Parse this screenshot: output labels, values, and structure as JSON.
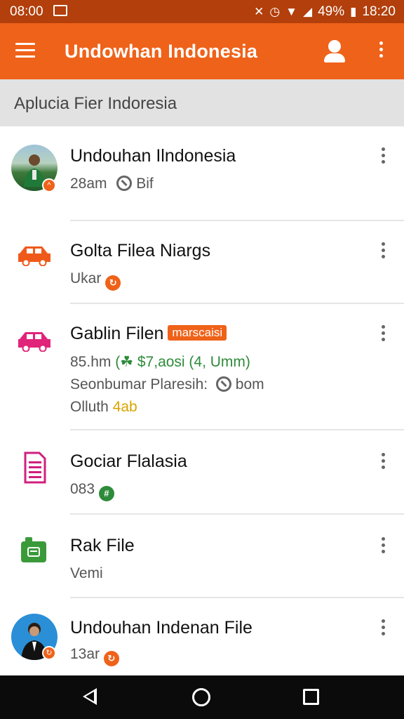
{
  "status_bar": {
    "time_left": "08:00",
    "battery": "49%",
    "time_right": "18:20"
  },
  "app_bar": {
    "title": "Undowhan Indonesia"
  },
  "subheader": {
    "label": "Aplucia Fier Indoresia"
  },
  "rows": [
    {
      "title": "Undouhan Ilndonesia",
      "line1a": "28am",
      "line1b": "Bif"
    },
    {
      "title": "Golta Filea Niargs",
      "line1": "Ukar"
    },
    {
      "title": "Gablin Filen",
      "tag": "marscaisi",
      "line1a": "85.hm",
      "line1b": "(☘ $7,aosi (4, Umm)",
      "line2a": "Seonbumar Plaresih:",
      "line2b": "bom",
      "line3a": "Olluth",
      "line3b": "4ab"
    },
    {
      "title": "Gociar Flalasia",
      "line1": "083"
    },
    {
      "title": "Rak File",
      "line1": "Vemi"
    },
    {
      "title": "Undouhan Indenan File",
      "line1": "13ar"
    }
  ],
  "colors": {
    "brand": "#ef6219",
    "status_bar": "#b23f0c",
    "subheader": "#e2e2e2",
    "car_orange": "#ef5a1b",
    "car_pink": "#e0247a",
    "doc_magenta": "#d0207e",
    "apk_green": "#3a9a3a"
  },
  "icons": [
    "menu-icon",
    "account-icon",
    "more-vert-icon",
    "car-icon",
    "document-icon",
    "apk-icon",
    "back-icon",
    "home-icon",
    "recents-icon"
  ]
}
